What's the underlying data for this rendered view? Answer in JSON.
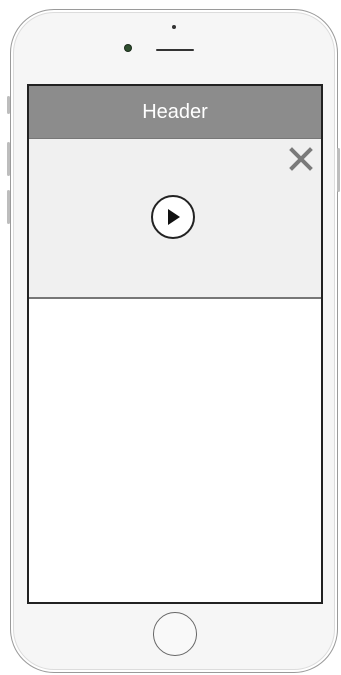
{
  "header": {
    "title": "Header"
  },
  "media": {
    "close_icon": "close-icon",
    "play_icon": "play-icon"
  },
  "device": {
    "home_button_icon": "home-button"
  },
  "colors": {
    "header_background": "#8c8c8c",
    "header_text": "#ffffff",
    "media_background": "#f0f0f0",
    "icon_gray": "#7a7a7a",
    "frame_border": "#9a9a9a",
    "screen_border": "#222222"
  }
}
